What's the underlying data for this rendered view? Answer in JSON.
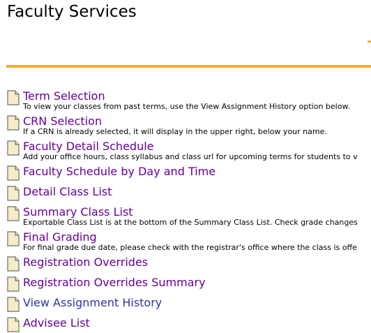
{
  "page": {
    "title": "Faculty Services"
  },
  "colors": {
    "accent_rule": "#f0b12e",
    "link_visited": "#660099",
    "link_unvisited": "#3131a9"
  },
  "menu": [
    {
      "icon": "document-icon",
      "label": "Term Selection",
      "description": "To view your classes from past terms, use the View Assignment History option below."
    },
    {
      "icon": "document-icon",
      "label": "CRN Selection",
      "description": "If a CRN is already selected, it will display in the upper right, below your name."
    },
    {
      "icon": "document-icon",
      "label": "Faculty Detail Schedule",
      "description": "Add your office hours, class syllabus and class url for upcoming terms for students to v"
    },
    {
      "icon": "document-icon",
      "label": "Faculty Schedule by Day and Time",
      "description": ""
    },
    {
      "icon": "document-icon",
      "label": "Detail Class List",
      "description": ""
    },
    {
      "icon": "document-icon",
      "label": "Summary Class List",
      "description": "Exportable Class List is at the bottom of the Summary Class List. Check grade changes"
    },
    {
      "icon": "document-icon",
      "label": "Final Grading",
      "description": "For final grade due date, please check with the registrar's office where the class is offe"
    },
    {
      "icon": "document-icon",
      "label": "Registration Overrides",
      "description": ""
    },
    {
      "icon": "document-icon",
      "label": "Registration Overrides Summary",
      "description": ""
    },
    {
      "icon": "document-icon",
      "label": "View Assignment History",
      "description": ""
    },
    {
      "icon": "document-icon",
      "label": "Advisee List",
      "description": ""
    }
  ]
}
